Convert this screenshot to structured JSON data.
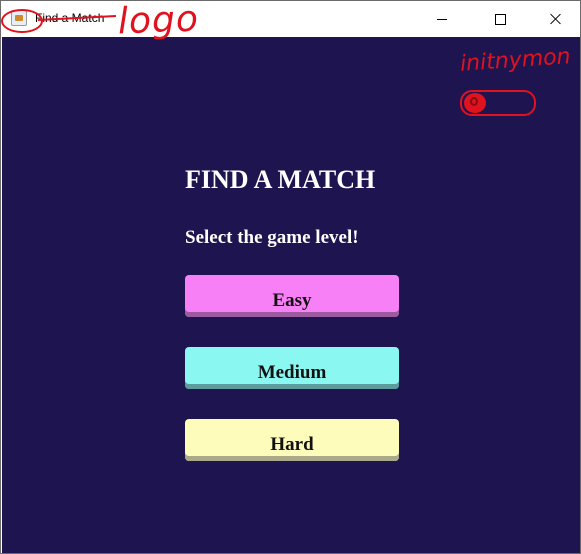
{
  "window": {
    "title": "Find a Match"
  },
  "main": {
    "heading": "FIND A MATCH",
    "subheading": "Select the game level!",
    "levels": [
      {
        "label": "Easy",
        "color": "#f880f6"
      },
      {
        "label": "Medium",
        "color": "#8af7f1"
      },
      {
        "label": "Hard",
        "color": "#fdfcba"
      }
    ],
    "background_color": "#1e1450"
  },
  "annotations": {
    "logo_note": "logo",
    "user_note": "initnymon",
    "toggle_icon": "toggle-switch-icon",
    "annotation_color": "#e0121e"
  }
}
